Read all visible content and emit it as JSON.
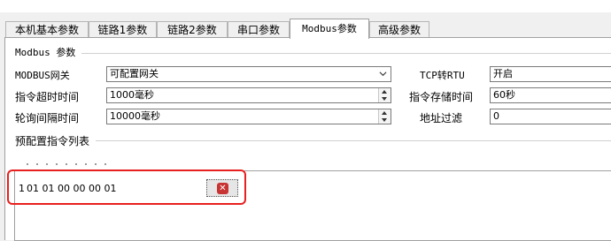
{
  "tabs": [
    {
      "label": "本机基本参数",
      "active": false
    },
    {
      "label": "链路1参数",
      "active": false
    },
    {
      "label": "链路2参数",
      "active": false
    },
    {
      "label": "串口参数",
      "active": false
    },
    {
      "label": "Modbus参数",
      "active": true
    },
    {
      "label": "高级参数",
      "active": false
    }
  ],
  "modbus_group": {
    "title": "Modbus 参数",
    "gateway_label": "MODBUS网关",
    "gateway_value": "可配置网关",
    "timeout_label": "指令超时时间",
    "timeout_value": "1000毫秒",
    "poll_label": "轮询间隔时间",
    "poll_value": "10000毫秒",
    "tcp_rtu_label": "TCP转RTU",
    "tcp_rtu_value": "开启",
    "storage_label": "指令存储时间",
    "storage_value": "60秒",
    "addr_filter_label": "地址过滤",
    "addr_filter_value": "0"
  },
  "preset_group": {
    "title": "预配置指令列表",
    "commands": [
      {
        "index": "1",
        "value": "01 01 00 00 00 01"
      }
    ]
  },
  "icons": {
    "dropdown": "chevron-down-icon",
    "delete": "delete-x-icon"
  },
  "colors": {
    "highlight": "#e8201f",
    "delete_icon": "#c83333"
  }
}
